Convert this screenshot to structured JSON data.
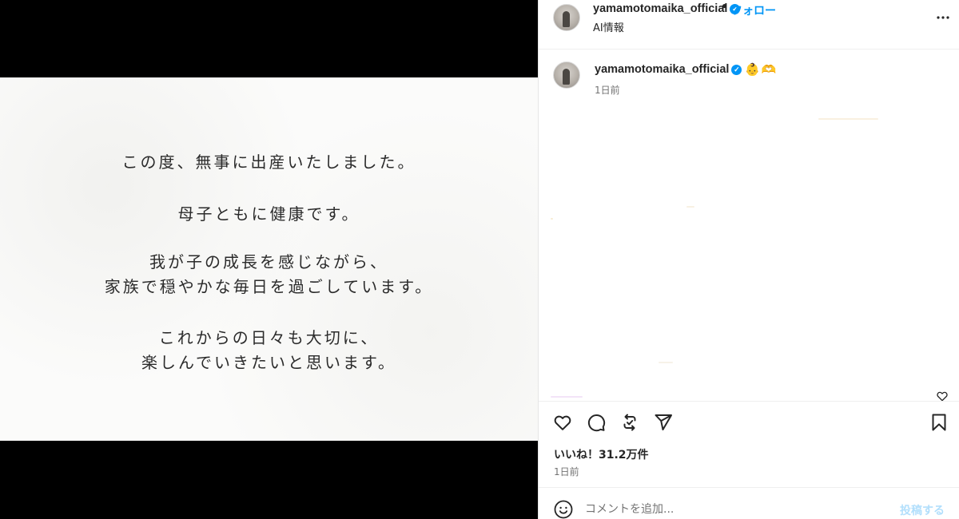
{
  "media": {
    "message_lines": [
      "この度、無事に出産いたしました。",
      "母子ともに健康です。",
      "我が子の成長を感じながら、",
      "家族で穏やかな毎日を過ごしています。",
      "これからの日々も大切に、",
      "楽しんでいきたいと思います。"
    ]
  },
  "header": {
    "username": "yamamotomaika_official",
    "separator": "•",
    "follow_label": "フォロー",
    "subtitle": "AI情報",
    "more_icon": "more-horizontal-icon"
  },
  "caption": {
    "username": "yamamotomaika_official",
    "emojis": "👶🫶",
    "timestamp": "1日前"
  },
  "actions": {
    "like_icon": "heart-icon",
    "comment_icon": "comment-icon",
    "repost_icon": "repost-icon",
    "share_icon": "send-icon",
    "save_icon": "bookmark-icon",
    "likes_text": "いいね！31.2万件",
    "timestamp": "1日前"
  },
  "comment": {
    "placeholder": "コメントを追加...",
    "post_label": "投稿する",
    "emoji_icon": "smile-icon"
  },
  "colors": {
    "accent": "#0095f6",
    "post_disabled": "#b2dffc",
    "text": "#262626",
    "muted": "#737373"
  }
}
